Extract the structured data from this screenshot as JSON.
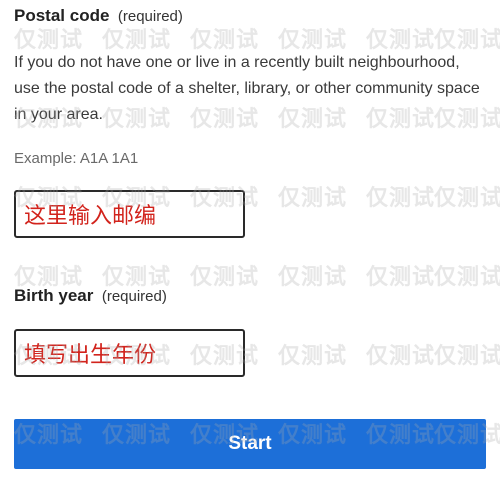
{
  "postal": {
    "label": "Postal code",
    "required": "(required)",
    "hint": "If you do not have one or live in a recently built neighbourhood, use the postal code of a shelter, library, or other community space in your area.",
    "example": "Example: A1A 1A1",
    "value": "这里输入邮编"
  },
  "birth_year": {
    "label": "Birth year",
    "required": "(required)",
    "value": "填写出生年份"
  },
  "start_button": {
    "label": "Start",
    "color": "#1d6fd8"
  },
  "watermark": {
    "text": "仅测试"
  },
  "colors": {
    "input_text": "#d2231c",
    "border": "#2a2a2a"
  }
}
